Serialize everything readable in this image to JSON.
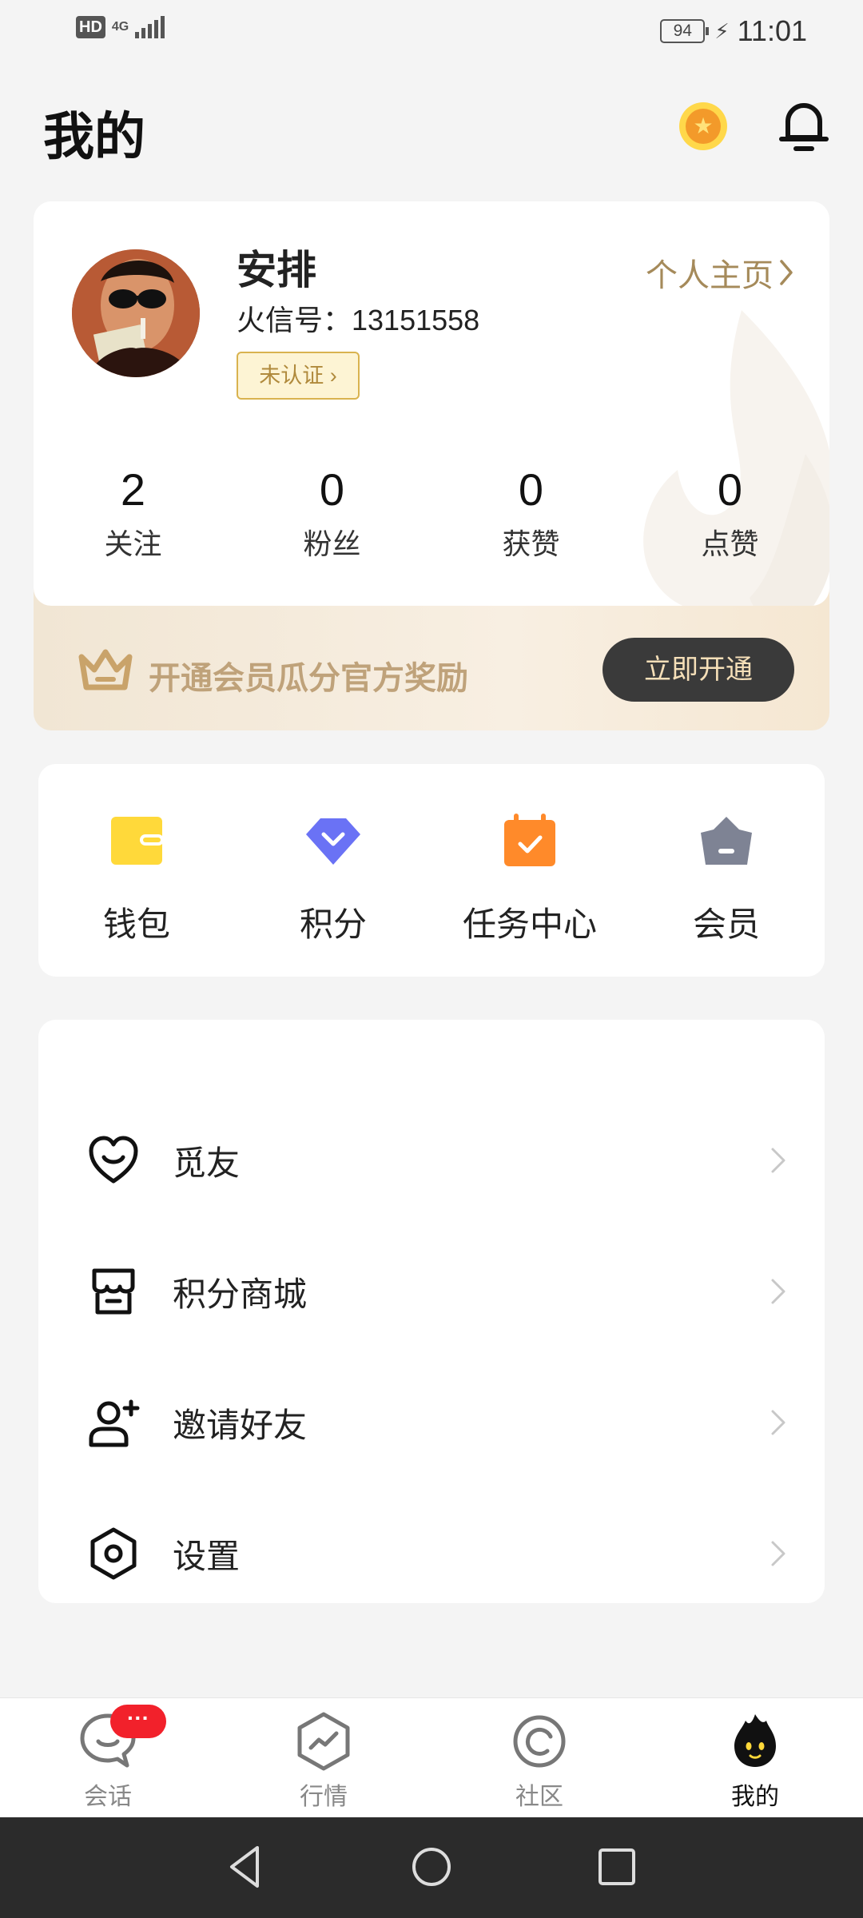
{
  "status_bar": {
    "hd": "HD",
    "network": "4G",
    "battery": "94",
    "time": "11:01"
  },
  "header": {
    "title": "我的"
  },
  "profile": {
    "name": "安排",
    "id_label": "火信号：",
    "id_value": "13151558",
    "cert_label": "未认证",
    "homepage_label": "个人主页",
    "stats": [
      {
        "num": "2",
        "label": "关注"
      },
      {
        "num": "0",
        "label": "粉丝"
      },
      {
        "num": "0",
        "label": "获赞"
      },
      {
        "num": "0",
        "label": "点赞"
      }
    ]
  },
  "vip": {
    "text": "开通会员瓜分官方奖励",
    "button": "立即开通"
  },
  "quick": [
    {
      "label": "钱包",
      "icon": "wallet-icon"
    },
    {
      "label": "积分",
      "icon": "points-diamond-icon"
    },
    {
      "label": "任务中心",
      "icon": "task-calendar-icon"
    },
    {
      "label": "会员",
      "icon": "member-crown-icon"
    }
  ],
  "menu": [
    {
      "label": "觅友",
      "icon": "heart-smile-icon"
    },
    {
      "label": "积分商城",
      "icon": "store-icon"
    },
    {
      "label": "邀请好友",
      "icon": "add-user-icon"
    },
    {
      "label": "设置",
      "icon": "settings-hexagon-icon"
    }
  ],
  "bottom_nav": {
    "tabs": [
      {
        "label": "会话",
        "icon": "chat-icon"
      },
      {
        "label": "行情",
        "icon": "market-icon"
      },
      {
        "label": "社区",
        "icon": "community-icon"
      },
      {
        "label": "我的",
        "icon": "flame-mascot-icon"
      }
    ],
    "chat_badge": "···",
    "active_index": 3
  },
  "colors": {
    "accent_gold": "#a58a5a",
    "badge_red": "#f2212b",
    "vip_button_bg": "#3a3a3a"
  }
}
